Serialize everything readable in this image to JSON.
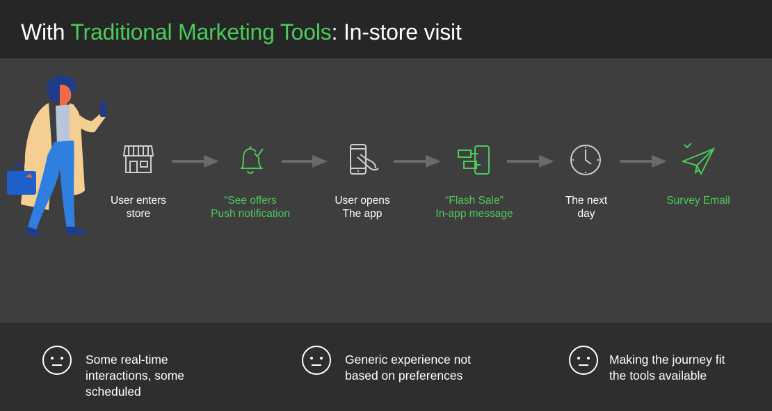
{
  "header": {
    "title_prefix": "With ",
    "title_accent": "Traditional Marketing Tools",
    "title_suffix": ": In-store visit"
  },
  "colors": {
    "accent": "#4ccb5a",
    "header_bg": "#262626",
    "stage_bg": "#3e3e3e",
    "footer_bg": "#2e2e2e",
    "arrow": "#6a6a6a"
  },
  "journey": {
    "steps": [
      {
        "icon": "store-icon",
        "label": "User enters\nstore",
        "color": "white"
      },
      {
        "icon": "bell-check-icon",
        "label": "“See offers\nPush notification",
        "color": "green"
      },
      {
        "icon": "phone-tap-icon",
        "label": "User opens\nThe app",
        "color": "white"
      },
      {
        "icon": "app-message-icon",
        "label": "“Flash Sale”\nIn-app message",
        "color": "green"
      },
      {
        "icon": "clock-icon",
        "label": "The next\nday",
        "color": "white"
      },
      {
        "icon": "paper-plane-icon",
        "label": "Survey Email",
        "color": "green"
      }
    ]
  },
  "footer": {
    "items": [
      {
        "icon": "neutral-face-icon",
        "text": "Some real-time\ninteractions, some\nscheduled"
      },
      {
        "icon": "neutral-face-icon",
        "text": "Generic experience not\nbased on preferences"
      },
      {
        "icon": "neutral-face-icon",
        "text": "Making the journey fit\nthe tools available"
      }
    ]
  }
}
